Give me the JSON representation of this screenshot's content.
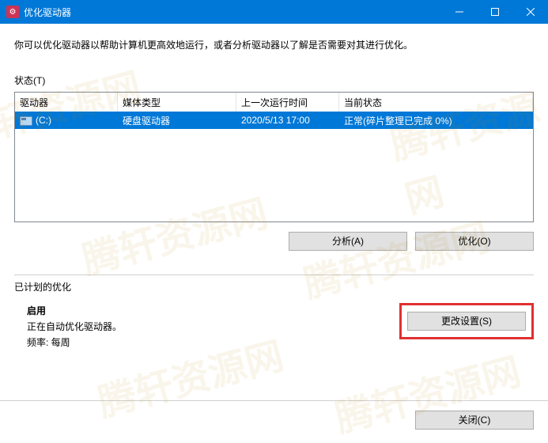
{
  "titlebar": {
    "title": "优化驱动器"
  },
  "description": "你可以优化驱动器以帮助计算机更高效地运行，或者分析驱动器以了解是否需要对其进行优化。",
  "status_label": "状态(T)",
  "columns": {
    "drive": "驱动器",
    "media": "媒体类型",
    "lastrun": "上一次运行时间",
    "status": "当前状态"
  },
  "drives": [
    {
      "name": "(C:)",
      "media": "硬盘驱动器",
      "lastrun": "2020/5/13 17:00",
      "status": "正常(碎片整理已完成 0%)"
    }
  ],
  "buttons": {
    "analyze": "分析(A)",
    "optimize": "优化(O)",
    "change_settings": "更改设置(S)",
    "close": "关闭(C)"
  },
  "scheduled": {
    "title": "已计划的优化",
    "enabled_label": "启用",
    "auto_text": "正在自动优化驱动器。",
    "freq_text": "频率: 每周"
  },
  "watermark": "腾轩资源网"
}
